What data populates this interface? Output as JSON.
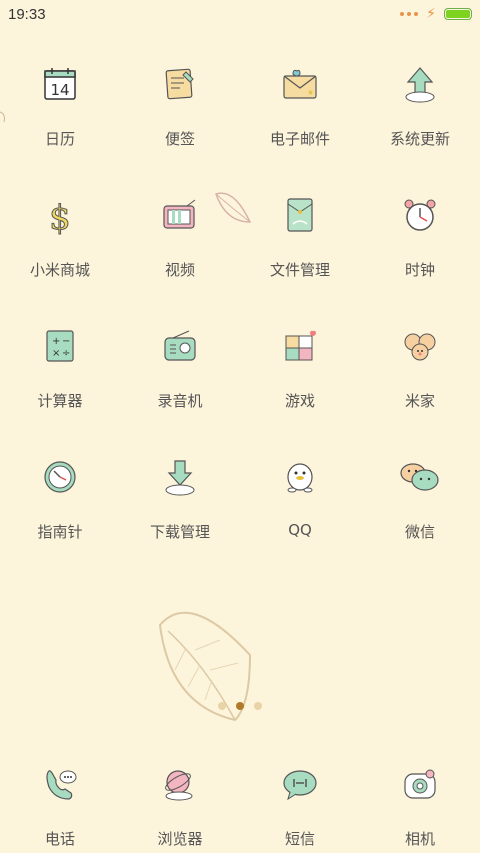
{
  "status_bar": {
    "time": "19:33",
    "battery_level": 1.0,
    "accent_color": "#e8944a",
    "battery_color": "#7ed321"
  },
  "apps": [
    {
      "label": "日历",
      "icon": "calendar-icon",
      "icon_text": "14"
    },
    {
      "label": "便签",
      "icon": "notes-icon"
    },
    {
      "label": "电子邮件",
      "icon": "email-icon"
    },
    {
      "label": "系统更新",
      "icon": "update-icon"
    },
    {
      "label": "小米商城",
      "icon": "mall-icon"
    },
    {
      "label": "视频",
      "icon": "video-icon"
    },
    {
      "label": "文件管理",
      "icon": "file-manager-icon"
    },
    {
      "label": "时钟",
      "icon": "clock-icon"
    },
    {
      "label": "计算器",
      "icon": "calculator-icon"
    },
    {
      "label": "录音机",
      "icon": "recorder-icon"
    },
    {
      "label": "游戏",
      "icon": "game-icon"
    },
    {
      "label": "米家",
      "icon": "mijia-icon"
    },
    {
      "label": "指南针",
      "icon": "compass-icon"
    },
    {
      "label": "下载管理",
      "icon": "download-icon"
    },
    {
      "label": "QQ",
      "icon": "qq-icon"
    },
    {
      "label": "微信",
      "icon": "wechat-icon"
    }
  ],
  "page_indicator": {
    "count": 3,
    "active": 1,
    "active_color": "#b07a2a",
    "inactive_color": "#e8d4a8"
  },
  "dock": [
    {
      "label": "电话",
      "icon": "phone-icon"
    },
    {
      "label": "浏览器",
      "icon": "browser-icon"
    },
    {
      "label": "短信",
      "icon": "sms-icon"
    },
    {
      "label": "相机",
      "icon": "camera-icon"
    }
  ]
}
